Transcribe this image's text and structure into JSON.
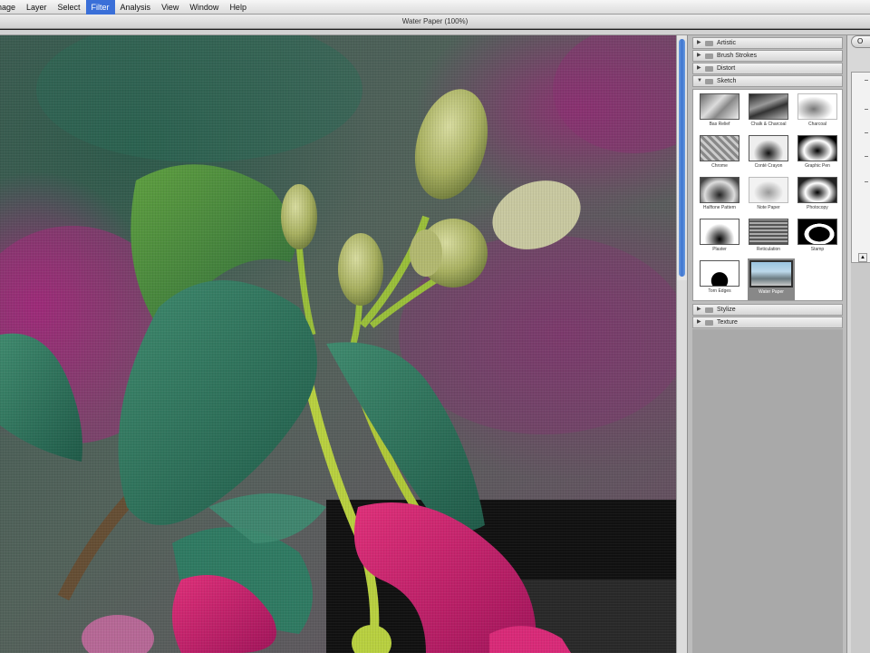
{
  "menubar": {
    "items": [
      "Image",
      "Layer",
      "Select",
      "Filter",
      "Analysis",
      "View",
      "Window",
      "Help"
    ],
    "active": "Filter"
  },
  "window": {
    "title": "Water Paper (100%)"
  },
  "gallery": {
    "categories_top": [
      {
        "label": "Artistic",
        "expanded": false
      },
      {
        "label": "Brush Strokes",
        "expanded": false
      },
      {
        "label": "Distort",
        "expanded": false
      },
      {
        "label": "Sketch",
        "expanded": true
      }
    ],
    "sketch_filters": [
      {
        "label": "Bas Relief"
      },
      {
        "label": "Chalk & Charcoal"
      },
      {
        "label": "Charcoal"
      },
      {
        "label": "Chrome"
      },
      {
        "label": "Conté Crayon"
      },
      {
        "label": "Graphic Pen"
      },
      {
        "label": "Halftone Pattern"
      },
      {
        "label": "Note Paper"
      },
      {
        "label": "Photocopy"
      },
      {
        "label": "Plaster"
      },
      {
        "label": "Reticulation"
      },
      {
        "label": "Stamp"
      },
      {
        "label": "Torn Edges"
      },
      {
        "label": "Water Paper",
        "selected": true
      }
    ],
    "categories_bottom": [
      {
        "label": "Stylize",
        "expanded": false
      },
      {
        "label": "Texture",
        "expanded": false
      }
    ]
  },
  "settings": {
    "ok_label": "O"
  },
  "colors": {
    "menu_active": "#3a6fd8",
    "scroll_thumb": "#3d74d0"
  }
}
